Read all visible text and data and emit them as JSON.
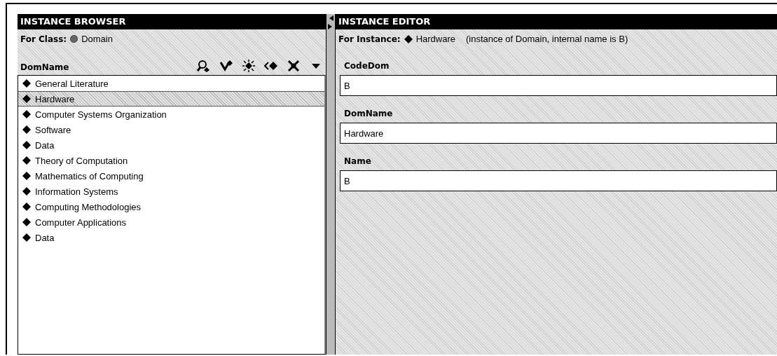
{
  "browser": {
    "title": "INSTANCE BROWSER",
    "class_label": "For Class:",
    "class_name": "Domain",
    "column": "DomName",
    "tools": [
      {
        "kind": "search"
      },
      {
        "kind": "create"
      },
      {
        "kind": "sparkle"
      },
      {
        "kind": "reference"
      },
      {
        "kind": "delete"
      },
      {
        "kind": "menu"
      }
    ],
    "items": [
      {
        "label": "General Literature",
        "selected": false
      },
      {
        "label": "Hardware",
        "selected": true
      },
      {
        "label": "Computer Systems Organization",
        "selected": false
      },
      {
        "label": "Software",
        "selected": false
      },
      {
        "label": "Data",
        "selected": false
      },
      {
        "label": "Theory of Computation",
        "selected": false
      },
      {
        "label": "Mathematics of Computing",
        "selected": false
      },
      {
        "label": "Information Systems",
        "selected": false
      },
      {
        "label": "Computing Methodologies",
        "selected": false
      },
      {
        "label": "Computer Applications",
        "selected": false
      },
      {
        "label": "Data",
        "selected": false
      }
    ]
  },
  "editor": {
    "title": "INSTANCE EDITOR",
    "instance_label": "For Instance:",
    "instance_name": "Hardware",
    "instance_note": "(instance of Domain, internal name is B)",
    "fields": [
      {
        "label": "CodeDom",
        "value": "B"
      },
      {
        "label": "DomName",
        "value": "Hardware"
      },
      {
        "label": "Name",
        "value": "B"
      }
    ]
  }
}
